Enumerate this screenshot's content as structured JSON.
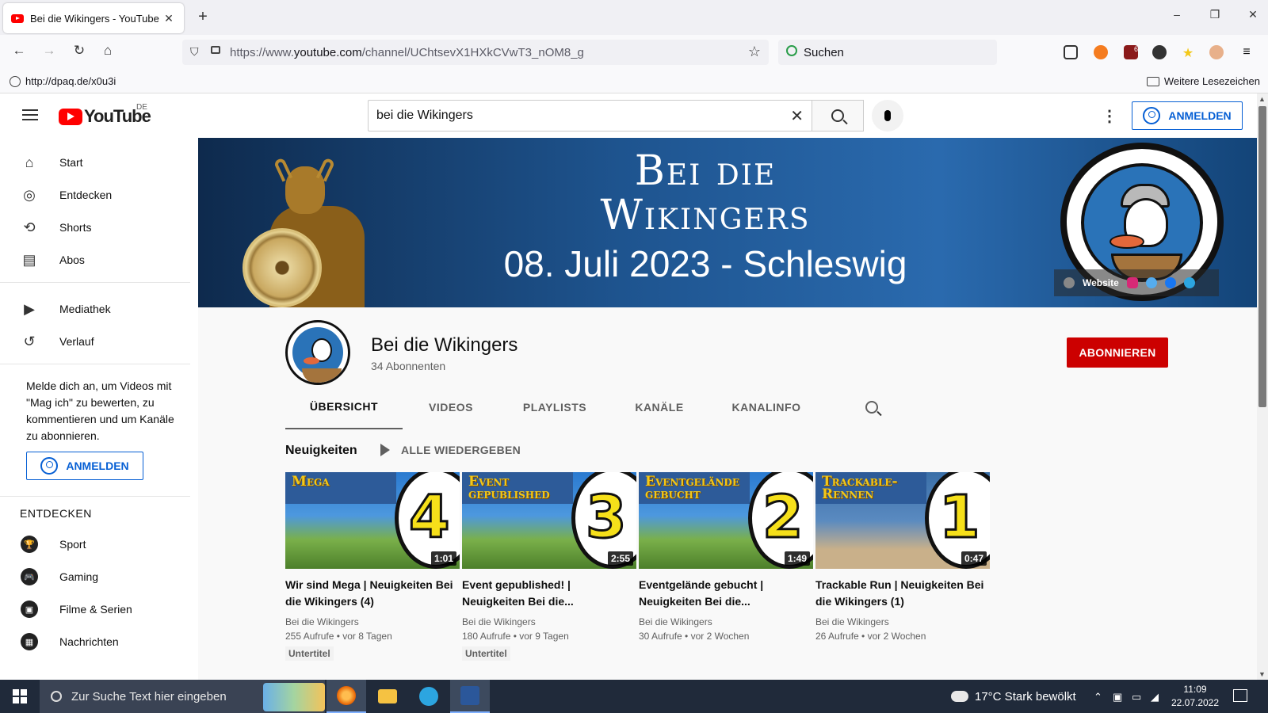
{
  "browser": {
    "tab_title": "Bei die Wikingers - YouTube",
    "tab_close": "✕",
    "new_tab": "+",
    "url_prefix": "https://www.",
    "url_host": "youtube.com",
    "url_path": "/channel/UChtsevX1HXkCVwT3_nOM8_g",
    "search_placeholder": "Suchen",
    "bookmark_left": "http://dpaq.de/x0u3i",
    "bookmark_right": "Weitere Lesezeichen",
    "window_controls": [
      "–",
      "❐",
      "✕"
    ],
    "extension_badge": "6"
  },
  "youtube": {
    "logo_text": "YouTube",
    "region": "DE",
    "search_value": "bei die Wikingers",
    "signin_label": "ANMELDEN",
    "sidebar": {
      "main": [
        {
          "label": "Start",
          "icon": "⌂"
        },
        {
          "label": "Entdecken",
          "icon": "◎"
        },
        {
          "label": "Shorts",
          "icon": "⟲"
        },
        {
          "label": "Abos",
          "icon": "▤"
        }
      ],
      "library": [
        {
          "label": "Mediathek",
          "icon": "▶"
        },
        {
          "label": "Verlauf",
          "icon": "↺"
        }
      ],
      "promo": "Melde dich an, um Videos mit \"Mag ich\" zu bewerten, zu kommentieren und um Kanäle zu abonnieren.",
      "signin_label": "ANMELDEN",
      "explore_heading": "ENTDECKEN",
      "explore": [
        {
          "label": "Sport",
          "icon": "🏆"
        },
        {
          "label": "Gaming",
          "icon": "🎮"
        },
        {
          "label": "Filme & Serien",
          "icon": "▣"
        },
        {
          "label": "Nachrichten",
          "icon": "▦"
        }
      ]
    },
    "banner": {
      "title_line1": "Bei die",
      "title_line2": "Wikingers",
      "date_line": "08. Juli 2023 - Schleswig",
      "website_link": "Website"
    },
    "channel": {
      "name": "Bei die Wikingers",
      "subscribers": "34 Abonnenten",
      "subscribe_label": "ABONNIEREN",
      "tabs": [
        "ÜBERSICHT",
        "VIDEOS",
        "PLAYLISTS",
        "KANÄLE",
        "KANALINFO"
      ]
    },
    "shelf": {
      "title": "Neuigkeiten",
      "play_all": "ALLE WIEDERGEBEN",
      "videos": [
        {
          "thumb_text": "Mega",
          "number": "4",
          "duration": "1:01",
          "title": "Wir sind Mega | Neuigkeiten Bei die Wikingers (4)",
          "channel": "Bei die Wikingers",
          "meta": "255 Aufrufe • vor 8 Tagen",
          "badge": "Untertitel"
        },
        {
          "thumb_text": "Event gepublished",
          "number": "3",
          "duration": "2:55",
          "title": "Event gepublished! | Neuigkeiten Bei die...",
          "channel": "Bei die Wikingers",
          "meta": "180 Aufrufe • vor 9 Tagen",
          "badge": "Untertitel"
        },
        {
          "thumb_text": "Eventgelände gebucht",
          "number": "2",
          "duration": "1:49",
          "title": "Eventgelände gebucht | Neuigkeiten Bei die...",
          "channel": "Bei die Wikingers",
          "meta": "30 Aufrufe • vor 2 Wochen",
          "badge": ""
        },
        {
          "thumb_text": "Trackable-Rennen",
          "number": "1",
          "duration": "0:47",
          "title": "Trackable Run | Neuigkeiten Bei die Wikingers (1)",
          "channel": "Bei die Wikingers",
          "meta": "26 Aufrufe • vor 2 Wochen",
          "badge": ""
        }
      ]
    }
  },
  "taskbar": {
    "search_placeholder": "Zur Suche Text hier eingeben",
    "weather": "17°C  Stark bewölkt",
    "time": "11:09",
    "date": "22.07.2022"
  },
  "colors": {
    "youtube_red": "#ff0000",
    "subscribe_red": "#cc0000",
    "link_blue": "#065fd4",
    "taskbar": "#202a3a"
  }
}
